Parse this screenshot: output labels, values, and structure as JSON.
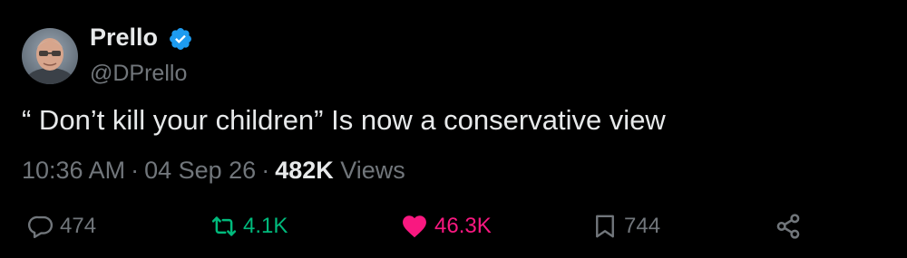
{
  "author": {
    "display_name": "Prello",
    "handle": "@DPrello",
    "verified": true,
    "verified_color": "#1d9bf0"
  },
  "tweet": {
    "text": "“ Don’t kill your children” Is now a conservative view"
  },
  "meta": {
    "time": "10:36 AM",
    "separator": "·",
    "date": "04 Sep 26",
    "views_count": "482K",
    "views_label": "Views"
  },
  "actions": {
    "reply_count": "474",
    "retweet_count": "4.1K",
    "like_count": "46.3K",
    "bookmark_count": "744",
    "retweet_color": "#00ba7c",
    "like_color": "#f91880"
  },
  "icons": [
    "avatar",
    "verified-badge-icon",
    "reply-icon",
    "retweet-icon",
    "like-icon",
    "bookmark-icon",
    "share-icon"
  ]
}
